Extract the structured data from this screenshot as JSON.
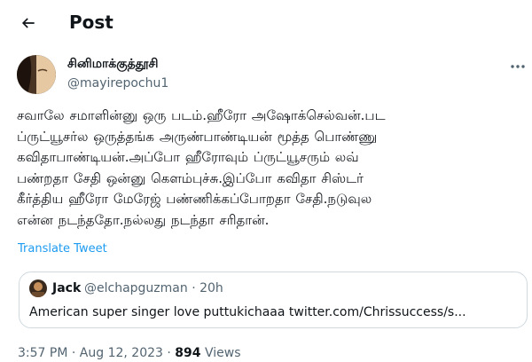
{
  "header": {
    "title": "Post",
    "back_icon": "arrow-left-icon"
  },
  "author": {
    "name": "சினிமாக்குத்தூசி",
    "handle": "@mayirepochu1"
  },
  "tweet": {
    "lines": [
      "சவாலே சமாளின்னு ஒரு படம்.ஹீரோ அஷோக்செல்வன்.பட",
      "ப்ருட்யூசர்ல ஒருத்தங்க அருண்பாண்டியன் மூத்த பொண்ணு",
      "கவிதாபாண்டியன்.அப்போ ஹீரோவும் ப்ருட்யூசரும் லவ்",
      "பண்றதா சேதி ஒன்னு கௌம்புச்சு.இப்போ கவிதா சிஸ்டர்",
      "கீர்த்திய ஹீரோ மேரேஜ் பண்ணிக்கப்போறதா சேதி.நடுவுல",
      "என்ன நடந்ததோ.நல்லது நடந்தா சரிதான்."
    ],
    "translate_label": "Translate Tweet"
  },
  "quote": {
    "name": "Jack",
    "handle": "@elchapguzman",
    "separator": "·",
    "time": "20h",
    "text": "American super singer love puttukichaaa twitter.com/Chrissuccess/s..."
  },
  "footer": {
    "time": "3:57 PM",
    "separator1": "·",
    "date": "Aug 12, 2023",
    "separator2": "·",
    "views_count": "894",
    "views_label": "Views"
  },
  "colors": {
    "link": "#1d9bf0",
    "secondary_text": "#536471",
    "border": "#cfd9de"
  }
}
